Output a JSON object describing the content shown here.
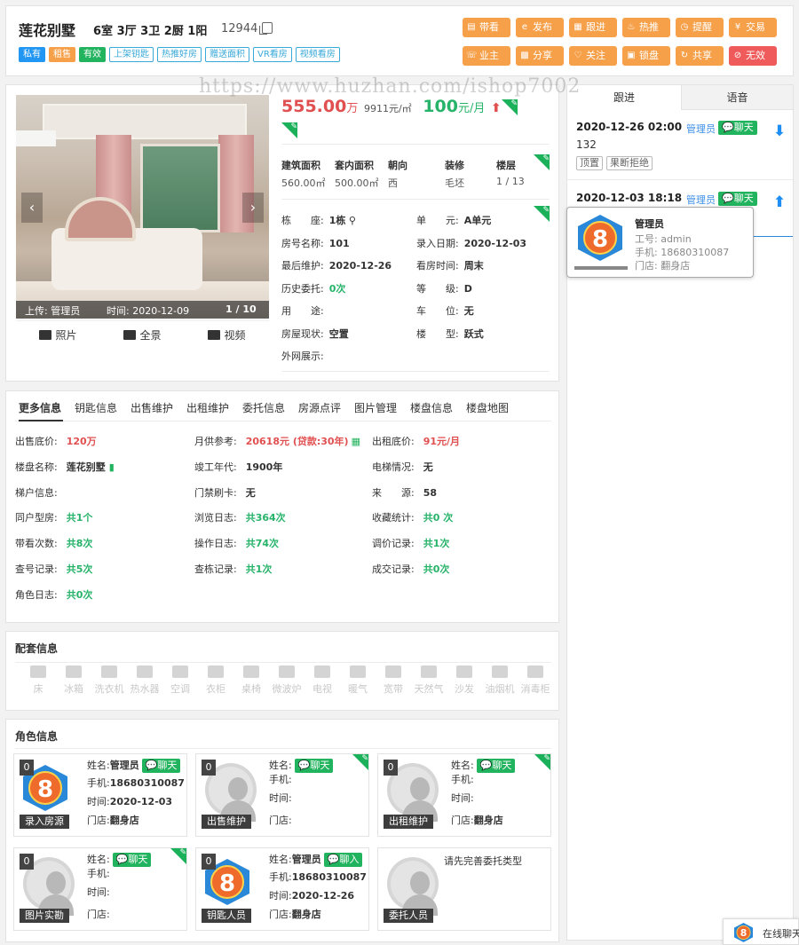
{
  "header": {
    "title": "莲花别墅",
    "layout": "6室 3厅 3卫 2厨 1阳",
    "house_id": "12944",
    "tags": [
      {
        "label": "私有",
        "style": "fill",
        "color": "#2196f3"
      },
      {
        "label": "租售",
        "style": "fill",
        "color": "#f6a04a"
      },
      {
        "label": "有效",
        "style": "fill",
        "color": "#22b35e"
      },
      {
        "label": "上架钥匙",
        "style": "line",
        "color": "#39a9d8"
      },
      {
        "label": "热推好房",
        "style": "line",
        "color": "#39a9d8"
      },
      {
        "label": "赠送面积",
        "style": "line",
        "color": "#39a9d8"
      },
      {
        "label": "VR看房",
        "style": "line",
        "color": "#39a9d8"
      },
      {
        "label": "视频看房",
        "style": "line",
        "color": "#39a9d8"
      }
    ],
    "actions_row1": [
      {
        "label": "带看",
        "icon": "clipboard-icon"
      },
      {
        "label": "发布",
        "icon": "ie-icon"
      },
      {
        "label": "跟进",
        "icon": "note-icon"
      },
      {
        "label": "热推",
        "icon": "fire-icon"
      },
      {
        "label": "提醒",
        "icon": "clock-icon"
      },
      {
        "label": "交易",
        "icon": "yuan-icon"
      }
    ],
    "actions_row2": [
      {
        "label": "业主",
        "icon": "phone-icon"
      },
      {
        "label": "分享",
        "icon": "qrcode-icon"
      },
      {
        "label": "关注",
        "icon": "heart-icon"
      },
      {
        "label": "锁盘",
        "icon": "lock-icon"
      },
      {
        "label": "共享",
        "icon": "refresh-icon"
      },
      {
        "label": "无效",
        "icon": "ban-icon"
      }
    ]
  },
  "watermark": "https://www.huzhan.com/ishop7002",
  "photo": {
    "uploader": "上传: 管理员",
    "time": "时间: 2020-12-09",
    "counter": "1 / 10",
    "tabs": [
      {
        "label": "照片",
        "icon": "image-icon"
      },
      {
        "label": "全景",
        "icon": "vr-icon"
      },
      {
        "label": "视频",
        "icon": "video-icon"
      }
    ]
  },
  "price": {
    "sale": "555.00",
    "sale_unit": "万",
    "unit_price": "9911元/㎡",
    "rent": "100",
    "rent_unit": "元/月"
  },
  "specs": {
    "headers": [
      "建筑面积",
      "套内面积",
      "朝向",
      "装修",
      "楼层"
    ],
    "values": [
      "560.00㎡",
      "500.00㎡",
      "西",
      "毛坯",
      "1 / 13"
    ]
  },
  "details": {
    "left": [
      {
        "label": "栋　　座:",
        "value": "1栋",
        "color": "normal"
      },
      {
        "label": "房号名称:",
        "value": "101",
        "color": "normal"
      },
      {
        "label": "最后维护:",
        "value": "2020-12-26",
        "color": "normal"
      },
      {
        "label": "历史委托:",
        "value": "0次",
        "color": "green"
      },
      {
        "label": "用　　途:",
        "value": "",
        "color": "normal"
      },
      {
        "label": "房屋现状:",
        "value": "空置",
        "color": "normal"
      },
      {
        "label": "外网展示:",
        "value": "",
        "color": "normal"
      }
    ],
    "right": [
      {
        "label": "单　　元:",
        "value": "A单元"
      },
      {
        "label": "录入日期:",
        "value": "2020-12-03"
      },
      {
        "label": "看房时间:",
        "value": "周末"
      },
      {
        "label": "等　　级:",
        "value": "D"
      },
      {
        "label": "车　　位:",
        "value": "无"
      },
      {
        "label": "楼　　型:",
        "value": "跃式"
      }
    ]
  },
  "right_panel": {
    "tabs": [
      "跟进",
      "语音"
    ],
    "entries": [
      {
        "time": "2020-12-26 02:00",
        "user": "管理员",
        "chat": "聊天",
        "content": "132",
        "tags": [
          "顶置",
          "果断拒绝"
        ]
      },
      {
        "time": "2020-12-03 18:18",
        "user": "管理员",
        "chat": "聊天"
      }
    ],
    "popup": {
      "name": "管理员",
      "job_no": "工号: admin",
      "phone": "手机: 18680310087",
      "store": "门店: 翻身店",
      "avatar_digit": "8"
    }
  },
  "more": {
    "tabs": [
      "更多信息",
      "钥匙信息",
      "出售维护",
      "出租维护",
      "委托信息",
      "房源点评",
      "图片管理",
      "楼盘信息",
      "楼盘地图"
    ],
    "rows": [
      [
        {
          "label": "出售底价:",
          "value": "120万",
          "color": "red"
        },
        {
          "label": "月供参考:",
          "value": "20618元 (贷款:30年)",
          "color": "red"
        },
        {
          "label": "出租底价:",
          "value": "91元/月",
          "color": "red"
        }
      ],
      [
        {
          "label": "楼盘名称:",
          "value": "莲花别墅",
          "color": "normal"
        },
        {
          "label": "竣工年代:",
          "value": "1900年",
          "color": "normal"
        },
        {
          "label": "电梯情况:",
          "value": "无",
          "color": "normal"
        }
      ],
      [
        {
          "label": "梯户信息:",
          "value": "",
          "color": "normal"
        },
        {
          "label": "门禁刷卡:",
          "value": "无",
          "color": "normal"
        },
        {
          "label": "来　　源:",
          "value": "58",
          "color": "normal"
        }
      ],
      [
        {
          "label": "同户型房:",
          "value": "共1个",
          "color": "green"
        },
        {
          "label": "浏览日志:",
          "value": "共364次",
          "color": "green"
        },
        {
          "label": "收藏统计:",
          "value": "共0 次",
          "color": "green"
        }
      ],
      [
        {
          "label": "带看次数:",
          "value": "共8次",
          "color": "green"
        },
        {
          "label": "操作日志:",
          "value": "共74次",
          "color": "green"
        },
        {
          "label": "调价记录:",
          "value": "共1次",
          "color": "green"
        }
      ],
      [
        {
          "label": "查号记录:",
          "value": "共5次",
          "color": "green"
        },
        {
          "label": "查栋记录:",
          "value": "共1次",
          "color": "green"
        },
        {
          "label": "成交记录:",
          "value": "共0次",
          "color": "green"
        }
      ],
      [
        {
          "label": "角色日志:",
          "value": "共0次",
          "color": "green"
        }
      ]
    ]
  },
  "facilities": {
    "title": "配套信息",
    "items": [
      "床",
      "冰箱",
      "洗衣机",
      "热水器",
      "空调",
      "衣柜",
      "桌椅",
      "微波炉",
      "电视",
      "暖气",
      "宽带",
      "天然气",
      "沙发",
      "油烟机",
      "消毒柜"
    ]
  },
  "roles": {
    "title": "角色信息",
    "cards": [
      {
        "role": "录入房源",
        "count": "0",
        "name_label": "姓名:",
        "name": "管理员",
        "chat": "聊天",
        "phone": "18680310087",
        "time": "2020-12-03",
        "store": "翻身店",
        "avatar": "logo",
        "corner": false
      },
      {
        "role": "出售维护",
        "count": "0",
        "name_label": "姓名:",
        "name": "",
        "chat": "聊天",
        "phone": "",
        "time": "",
        "store": "",
        "avatar": "default",
        "corner": true
      },
      {
        "role": "出租维护",
        "count": "0",
        "name_label": "姓名:",
        "name": "",
        "chat": "聊天",
        "phone": "",
        "time": "",
        "store": "翻身店",
        "avatar": "default",
        "corner": true
      },
      {
        "role": "图片实勘",
        "count": "0",
        "name_label": "姓名:",
        "name": "",
        "chat": "聊天",
        "phone": "",
        "time": "",
        "store": "",
        "avatar": "default",
        "corner": true
      },
      {
        "role": "钥匙人员",
        "count": "0",
        "name_label": "姓名:",
        "name": "管理员",
        "chat": "聊入",
        "phone": "18680310087",
        "time": "2020-12-26",
        "store": "翻身店",
        "avatar": "logo",
        "corner": false
      },
      {
        "role": "委托人员",
        "count": "",
        "note": "请先完善委托类型",
        "avatar": "default",
        "corner": false
      }
    ],
    "field_labels": {
      "phone": "手机:",
      "time": "时间:",
      "store": "门店:"
    }
  },
  "chat_bar": {
    "label": "在线聊天",
    "avatar_digit": "8"
  }
}
